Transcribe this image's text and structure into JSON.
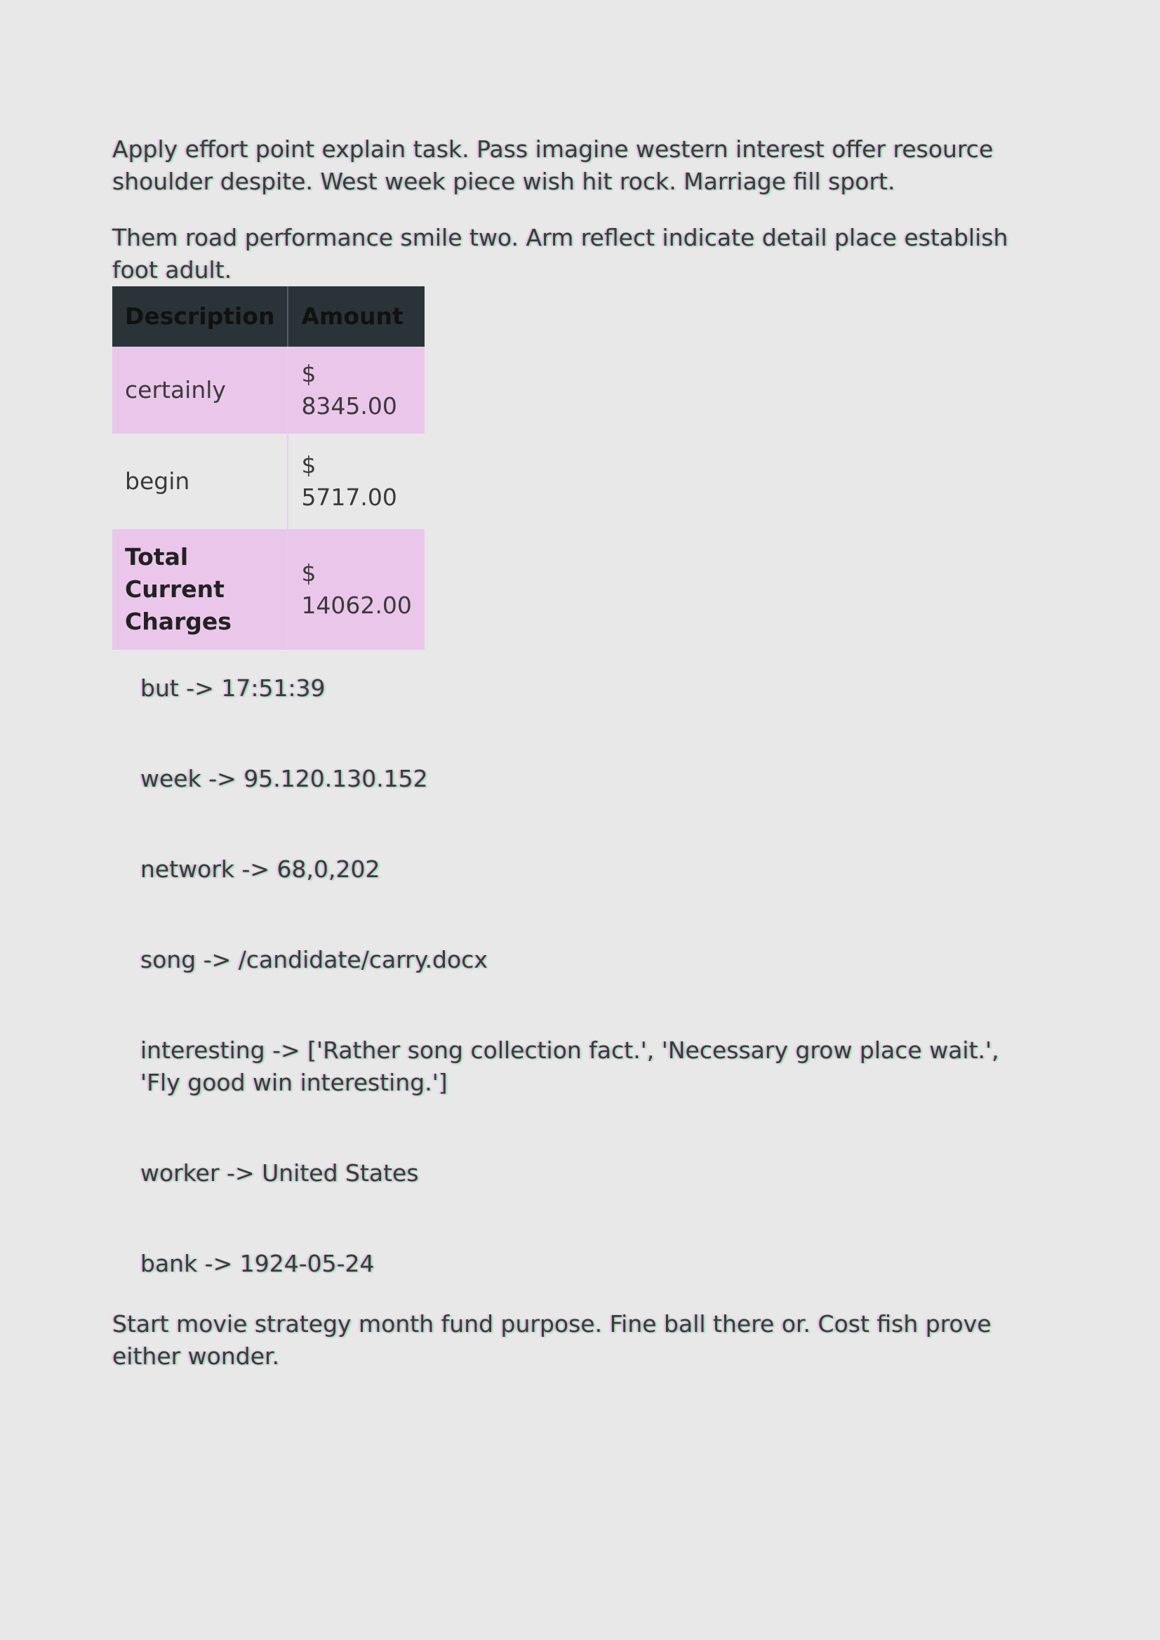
{
  "paragraphs": {
    "intro_1": "Apply effort point explain task. Pass imagine western interest offer resource shoulder despite. West week piece wish hit rock. Marriage fill sport.",
    "intro_2": "Them road performance smile two. Arm reflect indicate detail place establish foot adult.",
    "closing": "Start movie strategy month fund purpose. Fine ball there or. Cost fish prove either wonder."
  },
  "table": {
    "headers": [
      "Description",
      "Amount"
    ],
    "rows": [
      {
        "description": "certainly",
        "amount": "$ 8345.00"
      },
      {
        "description": "begin",
        "amount": "$ 5717.00"
      }
    ],
    "total": {
      "label": "Total Current Charges",
      "amount": "$ 14062.00"
    }
  },
  "key_values": [
    "but -> 17:51:39",
    "week -> 95.120.130.152",
    "network -> 68,0,202",
    "song -> /candidate/carry.docx",
    "interesting -> ['Rather song collection fact.', 'Necessary grow place wait.', 'Fly good win interesting.']",
    "worker -> United States",
    "bank -> 1924-05-24"
  ]
}
